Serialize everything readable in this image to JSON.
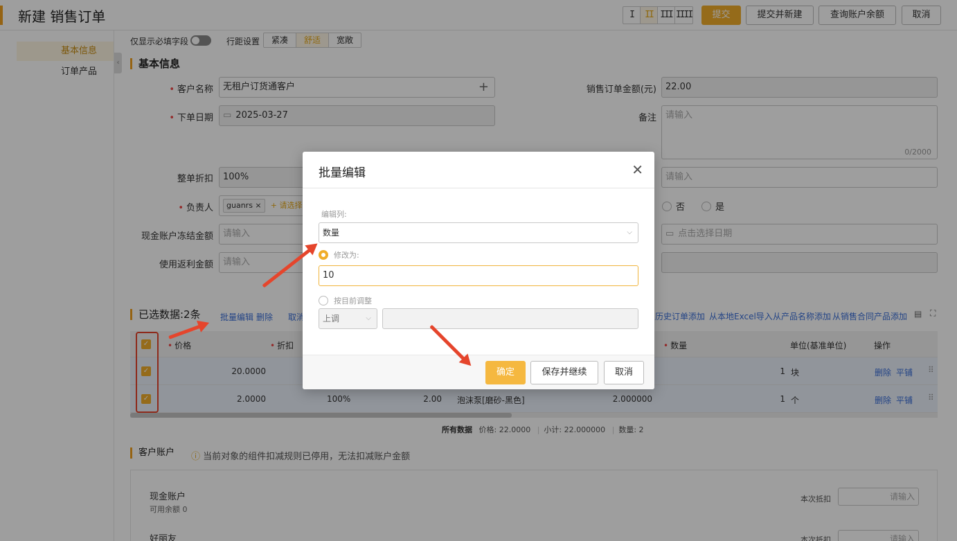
{
  "header": {
    "title": "新建 销售订单",
    "density": [
      "I",
      "II",
      "III",
      "IIII"
    ],
    "buttons": {
      "submit": "提交",
      "submit_new": "提交并新建",
      "query_balance": "查询账户余额",
      "cancel": "取消"
    }
  },
  "sidebar": {
    "items": [
      "基本信息",
      "订单产品"
    ]
  },
  "toolbar": {
    "required_only_label": "仅显示必填字段",
    "spacing_label": "行距设置",
    "spacing_options": [
      "紧凑",
      "舒适",
      "宽敞"
    ]
  },
  "basic_info": {
    "title": "基本信息",
    "customer_label": "客户名称",
    "customer_value": "无租户订货通客户",
    "date_label": "下单日期",
    "date_value": "2025-03-27",
    "discount_label": "整单折扣",
    "discount_value": "100%",
    "owner_label": "负责人",
    "owner_tag": "guanrs",
    "owner_add": "+ 请选择人",
    "freeze_label": "现金账户冻结金额",
    "freeze_placeholder": "请输入",
    "rebate_label": "使用返利金额",
    "rebate_placeholder": "请输入",
    "amount_label": "销售订单金额(元)",
    "amount_value": "22.00",
    "remark_label": "备注",
    "remark_placeholder": "请输入",
    "remark_count": "0/2000",
    "right_input_placeholder": "请输入",
    "radio_no": "否",
    "radio_yes": "是",
    "date_pick_placeholder": "点击选择日期"
  },
  "selected": {
    "title": "已选数据:2条",
    "actions": {
      "batch_edit": "批量编辑",
      "delete": "删除",
      "cancel": "取消"
    },
    "add_links": [
      "从历史订单添加",
      "从本地Excel导入",
      "从产品名称添加",
      "从销售合同产品添加"
    ]
  },
  "table": {
    "columns": {
      "price": "价格",
      "discount": "折扣",
      "qty": "数量",
      "unit": "单位(基准单位)",
      "ops": "操作"
    },
    "rows": [
      {
        "price": "20.0000",
        "qty": "1",
        "unit": "块",
        "delete": "删除",
        "tile": "平铺"
      },
      {
        "price": "2.0000",
        "discount": "100%",
        "amount": "2.00",
        "product": "泡沫泵[磨砂-黑色]",
        "qty_dec": "2.000000",
        "qty": "1",
        "unit": "个",
        "delete": "删除",
        "tile": "平铺"
      }
    ],
    "summary": {
      "label": "所有数据",
      "price": "价格: 22.0000",
      "subtotal": "小计: 22.000000",
      "qty": "数量: 2"
    }
  },
  "account": {
    "title": "客户账户",
    "notice": "当前对象的组件扣减规则已停用，无法扣减账户金额",
    "cash_name": "现金账户",
    "cash_balance": "可用余额 0",
    "deduct_label": "本次抵扣",
    "deduct_placeholder": "请输入",
    "friend_name": "好丽友"
  },
  "modal": {
    "title": "批量编辑",
    "edit_col_label": "编辑列:",
    "edit_col_value": "数量",
    "modify_label": "修改为:",
    "modify_value": "10",
    "adjust_label": "按目前调整",
    "adjust_dir": "上调",
    "buttons": {
      "ok": "确定",
      "save_continue": "保存并继续",
      "cancel": "取消"
    }
  },
  "colors": {
    "accent": "#f0ad2a",
    "link": "#3a6fd8",
    "annotation": "#e5452c"
  }
}
